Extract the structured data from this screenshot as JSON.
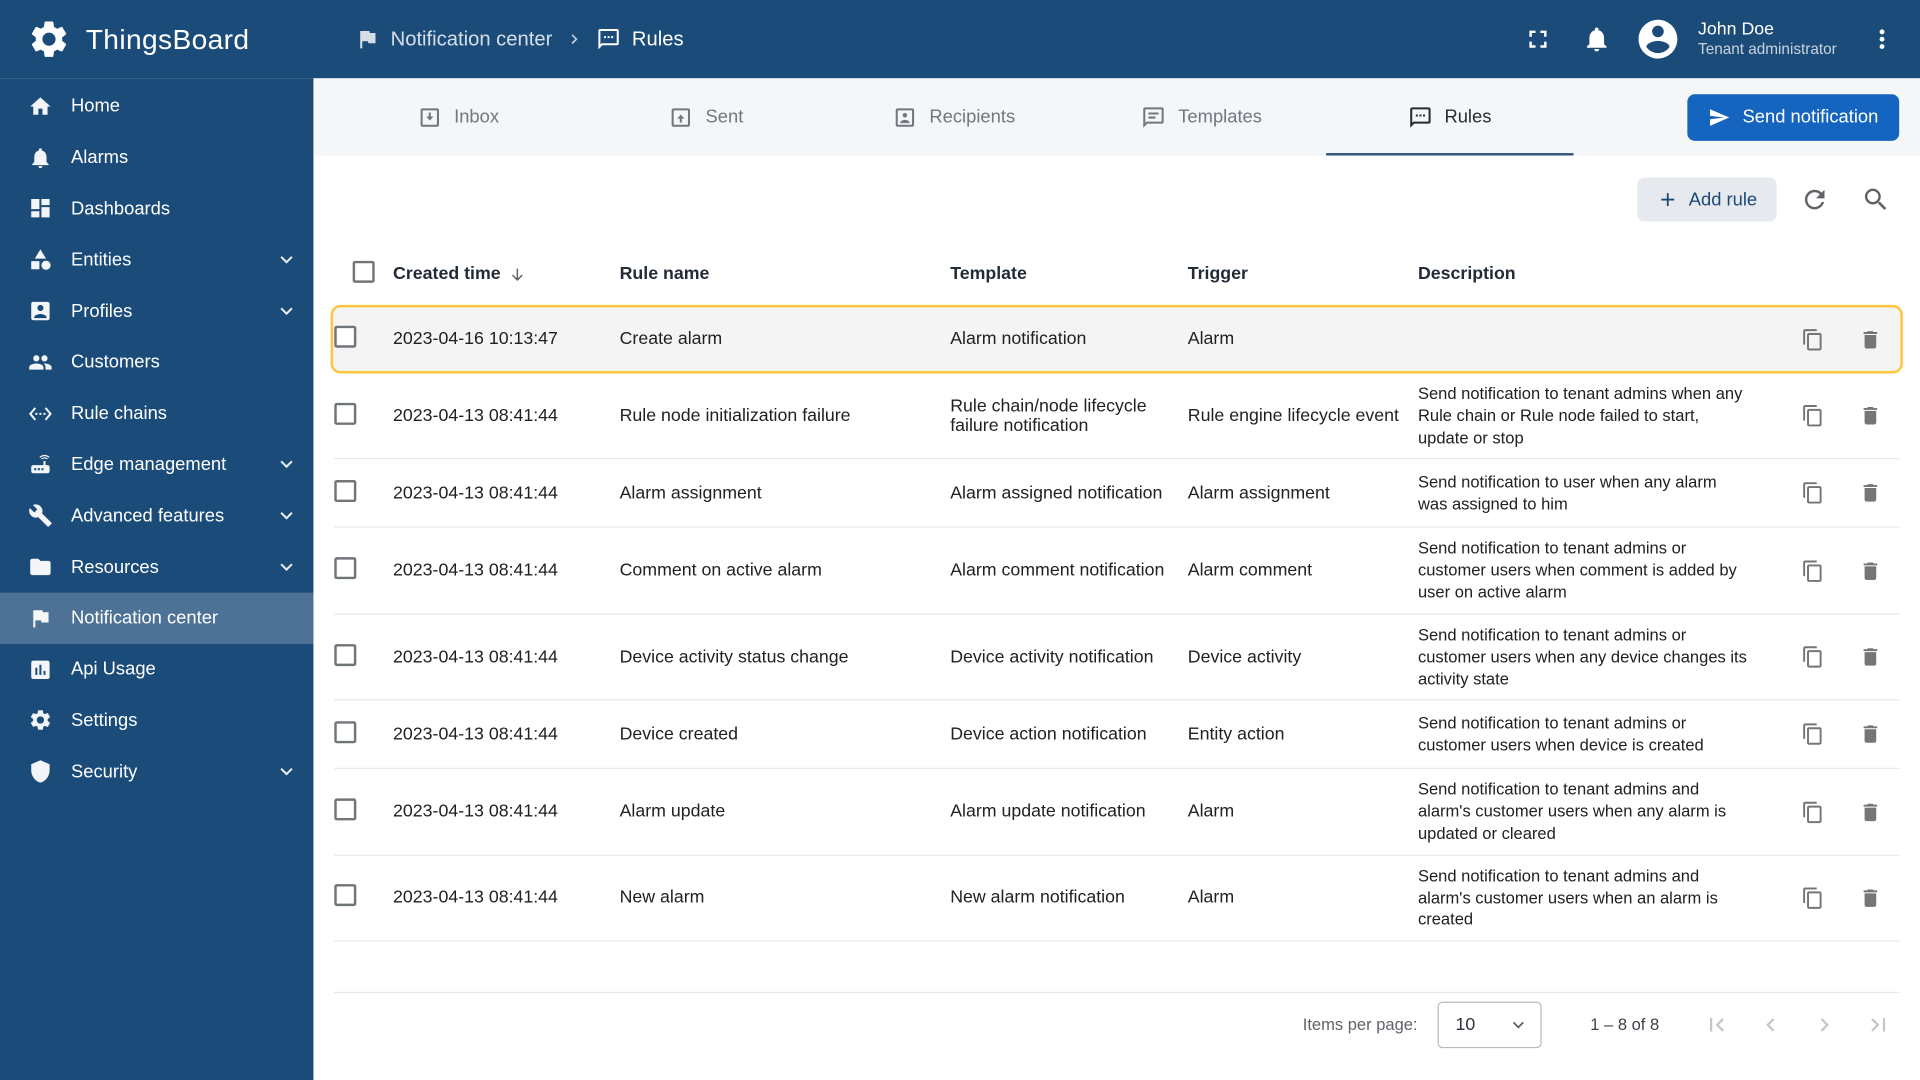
{
  "app": {
    "title": "ThingsBoard"
  },
  "colors": {
    "primary": "#1b4b79",
    "accent": "#1565c0",
    "highlight": "#ffc53d",
    "tab_underline": "#305680"
  },
  "header": {
    "breadcrumb": [
      {
        "label": "Notification center",
        "icon": "notification"
      },
      {
        "label": "Rules",
        "icon": "rules"
      }
    ],
    "user": {
      "name": "John Doe",
      "role": "Tenant administrator"
    }
  },
  "sidebar": {
    "items": [
      {
        "label": "Home",
        "icon": "home",
        "expandable": false,
        "active": false
      },
      {
        "label": "Alarms",
        "icon": "bell",
        "expandable": false,
        "active": false
      },
      {
        "label": "Dashboards",
        "icon": "dashboards",
        "expandable": false,
        "active": false
      },
      {
        "label": "Entities",
        "icon": "entities",
        "expandable": true,
        "active": false
      },
      {
        "label": "Profiles",
        "icon": "profiles",
        "expandable": true,
        "active": false
      },
      {
        "label": "Customers",
        "icon": "customers",
        "expandable": false,
        "active": false
      },
      {
        "label": "Rule chains",
        "icon": "rule-chains",
        "expandable": false,
        "active": false
      },
      {
        "label": "Edge management",
        "icon": "edge",
        "expandable": true,
        "active": false
      },
      {
        "label": "Advanced features",
        "icon": "advanced",
        "expandable": true,
        "active": false
      },
      {
        "label": "Resources",
        "icon": "resources",
        "expandable": true,
        "active": false
      },
      {
        "label": "Notification center",
        "icon": "notification",
        "expandable": false,
        "active": true
      },
      {
        "label": "Api Usage",
        "icon": "api",
        "expandable": false,
        "active": false
      },
      {
        "label": "Settings",
        "icon": "settings",
        "expandable": false,
        "active": false
      },
      {
        "label": "Security",
        "icon": "security",
        "expandable": true,
        "active": false
      }
    ]
  },
  "tabs": [
    {
      "label": "Inbox",
      "icon": "inbox",
      "active": false
    },
    {
      "label": "Sent",
      "icon": "sent",
      "active": false
    },
    {
      "label": "Recipients",
      "icon": "recipients",
      "active": false
    },
    {
      "label": "Templates",
      "icon": "templates",
      "active": false
    },
    {
      "label": "Rules",
      "icon": "rules",
      "active": true
    }
  ],
  "actions": {
    "send_notification": "Send notification",
    "add_rule": "Add rule"
  },
  "table": {
    "columns": [
      "Created time",
      "Rule name",
      "Template",
      "Trigger",
      "Description"
    ],
    "rows": [
      {
        "created": "2023-04-16 10:13:47",
        "name": "Create alarm",
        "template": "Alarm notification",
        "trigger": "Alarm",
        "description": "",
        "highlighted": true
      },
      {
        "created": "2023-04-13 08:41:44",
        "name": "Rule node initialization failure",
        "template": "Rule chain/node lifecycle failure notification",
        "trigger": "Rule engine lifecycle event",
        "description": "Send notification to tenant admins when any Rule chain or Rule node failed to start, update or stop",
        "highlighted": false
      },
      {
        "created": "2023-04-13 08:41:44",
        "name": "Alarm assignment",
        "template": "Alarm assigned notification",
        "trigger": "Alarm assignment",
        "description": "Send notification to user when any alarm was assigned to him",
        "highlighted": false
      },
      {
        "created": "2023-04-13 08:41:44",
        "name": "Comment on active alarm",
        "template": "Alarm comment notification",
        "trigger": "Alarm comment",
        "description": "Send notification to tenant admins or customer users when comment is added by user on active alarm",
        "highlighted": false
      },
      {
        "created": "2023-04-13 08:41:44",
        "name": "Device activity status change",
        "template": "Device activity notification",
        "trigger": "Device activity",
        "description": "Send notification to tenant admins or customer users when any device changes its activity state",
        "highlighted": false
      },
      {
        "created": "2023-04-13 08:41:44",
        "name": "Device created",
        "template": "Device action notification",
        "trigger": "Entity action",
        "description": "Send notification to tenant admins or customer users when device is created",
        "highlighted": false
      },
      {
        "created": "2023-04-13 08:41:44",
        "name": "Alarm update",
        "template": "Alarm update notification",
        "trigger": "Alarm",
        "description": "Send notification to tenant admins and alarm's customer users when any alarm is updated or cleared",
        "highlighted": false
      },
      {
        "created": "2023-04-13 08:41:44",
        "name": "New alarm",
        "template": "New alarm notification",
        "trigger": "Alarm",
        "description": "Send notification to tenant admins and alarm's customer users when an alarm is created",
        "highlighted": false
      }
    ]
  },
  "pagination": {
    "items_per_page_label": "Items per page:",
    "items_per_page": "10",
    "range": "1 – 8 of 8"
  }
}
